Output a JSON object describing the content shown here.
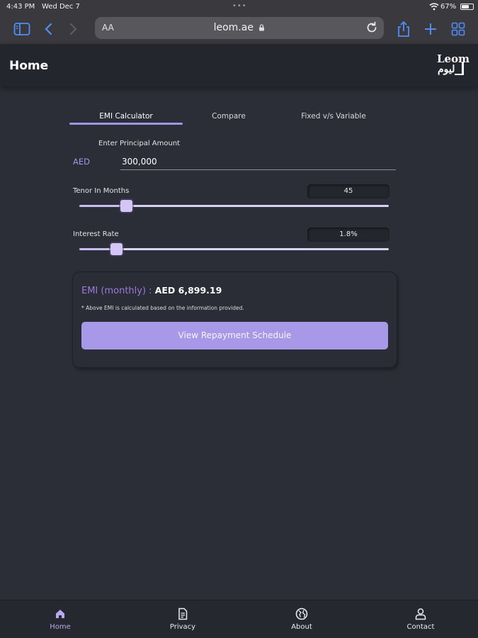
{
  "status_bar": {
    "time": "4:43 PM",
    "date": "Wed Dec 7",
    "battery": "67%",
    "battery_level": 0.67
  },
  "browser": {
    "text_size_label": "AA",
    "url": "leom.ae"
  },
  "header": {
    "title": "Home",
    "logo_text_top": "Leom",
    "logo_text_bottom": "ليوم"
  },
  "tabs": [
    {
      "label": "EMI Calculator",
      "active": true
    },
    {
      "label": "Compare",
      "active": false
    },
    {
      "label": "Fixed v/s Variable",
      "active": false
    }
  ],
  "calculator": {
    "principal_label": "Enter Principal Amount",
    "currency": "AED",
    "principal_value": "300,000",
    "tenor": {
      "label": "Tenor In Months",
      "value": "45",
      "fraction": 0.15
    },
    "interest": {
      "label": "Interest Rate",
      "value": "1.8%",
      "fraction": 0.12
    }
  },
  "result": {
    "emi_label": "EMI (monthly) : ",
    "emi_value": "AED 6,899.19",
    "disclaimer": "* Above EMI is calculated based on the information provided.",
    "button_label": "View Repayment Schedule"
  },
  "bottom_nav": [
    {
      "label": "Home",
      "icon": "home-icon",
      "active": true
    },
    {
      "label": "Privacy",
      "icon": "document-icon",
      "active": false
    },
    {
      "label": "About",
      "icon": "globe-icon",
      "active": false
    },
    {
      "label": "Contact",
      "icon": "person-icon",
      "active": false
    }
  ],
  "colors": {
    "accent": "#a594e3",
    "button": "#a898e8",
    "emi_label": "#9d78df",
    "background": "#2b2e37"
  }
}
